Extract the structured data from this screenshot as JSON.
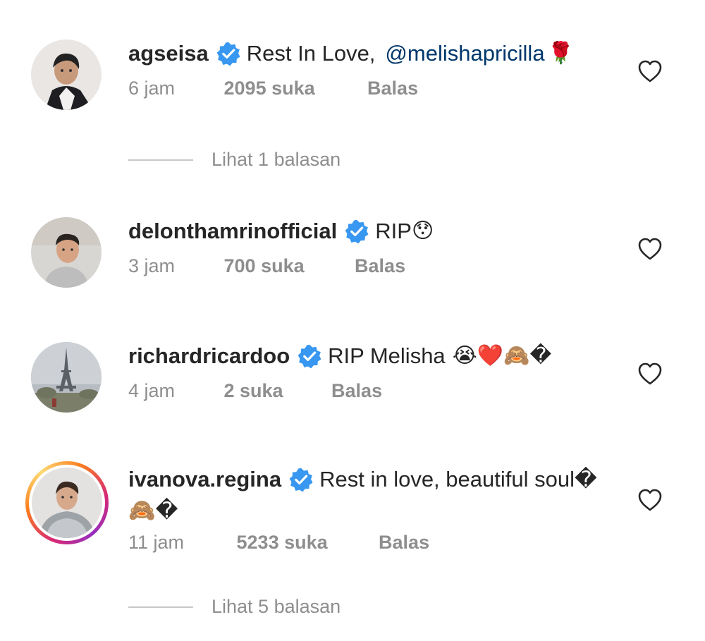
{
  "comments": [
    {
      "username": "agseisa",
      "text": "Rest In Love,",
      "mention": "@melishapricilla",
      "emoji": "🌹",
      "time": "6 jam",
      "likes": "2095 suka",
      "reply": "Balas",
      "view_replies": "Lihat 1 balasan"
    },
    {
      "username": "delonthamrinofficial",
      "text": "RIP",
      "emoji": "😯",
      "time": "3 jam",
      "likes": "700 suka",
      "reply": "Balas"
    },
    {
      "username": "richardricardoo",
      "text": "RIP Melisha",
      "emoji": "😭❤️🙈�",
      "time": "4 jam",
      "likes": "2 suka",
      "reply": "Balas"
    },
    {
      "username": "ivanova.regina",
      "text": "Rest in love, beautiful soul�",
      "continuation": "🙈�",
      "time": "11 jam",
      "likes": "5233 suka",
      "reply": "Balas",
      "view_replies": "Lihat 5 balasan"
    }
  ],
  "colors": {
    "verified": "#3897f0",
    "mention": "#00376b",
    "muted": "#8e8e8e"
  },
  "icons": {
    "verified": "verified-badge-icon",
    "like": "heart-outline-icon"
  }
}
